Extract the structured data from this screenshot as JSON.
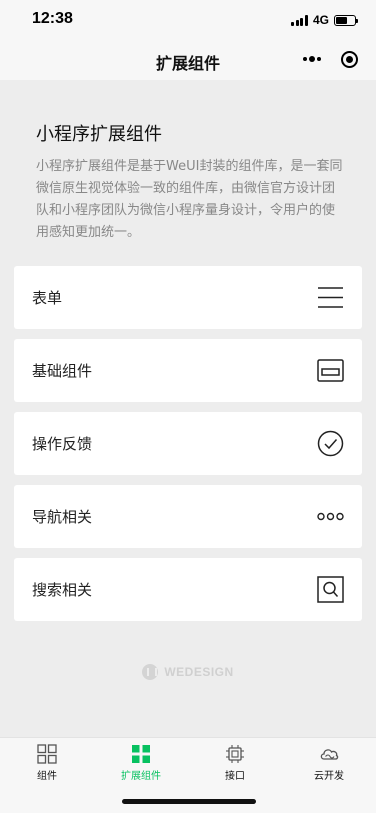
{
  "status": {
    "time": "12:38",
    "network": "4G",
    "battery_level": 0.6
  },
  "nav": {
    "title": "扩展组件"
  },
  "header": {
    "title": "小程序扩展组件",
    "description": "小程序扩展组件是基于WeUI封装的组件库，是一套同微信原生视觉体验一致的组件库，由微信官方设计团队和小程序团队为微信小程序量身设计，令用户的使用感知更加统一。"
  },
  "menu": {
    "items": [
      {
        "label": "表单",
        "icon": "list-lines-icon"
      },
      {
        "label": "基础组件",
        "icon": "card-icon"
      },
      {
        "label": "操作反馈",
        "icon": "check-circle-icon"
      },
      {
        "label": "导航相关",
        "icon": "dots-icon"
      },
      {
        "label": "搜索相关",
        "icon": "search-box-icon"
      }
    ]
  },
  "footer": {
    "logo_text": "WEDESIGN"
  },
  "tabbar": {
    "active_color": "#07c160",
    "items": [
      {
        "label": "组件",
        "icon": "grid-outline-icon",
        "active": false
      },
      {
        "label": "扩展组件",
        "icon": "grid-filled-icon",
        "active": true
      },
      {
        "label": "接口",
        "icon": "chip-icon",
        "active": false
      },
      {
        "label": "云开发",
        "icon": "cloud-icon",
        "active": false
      }
    ]
  }
}
